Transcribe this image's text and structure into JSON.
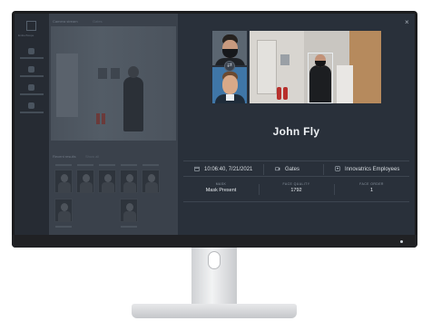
{
  "app": {
    "logo_text": "EmberScope",
    "live_title": "Camera stream",
    "live_sub": "Gates",
    "recent_title": "Recent results",
    "recent_sub": "Show all"
  },
  "detail": {
    "close_label": "×",
    "person_name": "John Fly",
    "swap_glyph": "⇄",
    "timestamp": "10:06:40, 7/21/2021",
    "camera": "Gates",
    "watchlist": "Innovatrics Employees",
    "attributes": [
      {
        "key": "MASK",
        "value": "Mask Present"
      },
      {
        "key": "FACE QUALITY",
        "value": "1792"
      },
      {
        "key": "FACE ORDER",
        "value": "1"
      }
    ]
  },
  "colors": {
    "panel_bg": "#29303a",
    "text_primary": "#eef1f4",
    "text_muted": "#8a94a0"
  },
  "icons": [
    "calendar-icon",
    "camera-icon",
    "watchlist-icon",
    "close-icon",
    "swap-icon"
  ]
}
